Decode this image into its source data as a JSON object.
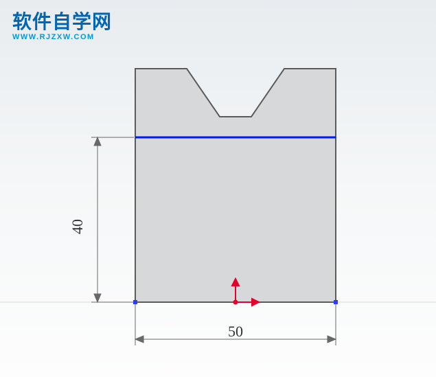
{
  "watermark": {
    "title": "软件自学网",
    "url": "WWW.RJZXW.COM"
  },
  "dimensions": {
    "height_label": "40",
    "width_label": "50"
  },
  "chart_data": {
    "type": "diagram",
    "description": "CAD 2D sketch of extruded block with V-notch on top",
    "outer_width": 50,
    "lower_rect_height": 40,
    "upper_section_height_approx": 20,
    "notch": {
      "shape": "V",
      "direction": "down",
      "top_span_fraction_approx": 0.5
    },
    "highlighted_edge": {
      "color": "blue",
      "position": "horizontal line at top of 40-height rectangle"
    },
    "origin_marker": {
      "color": "red",
      "type": "coordinate-origin-arrows",
      "position": "bottom-center"
    },
    "units": "unspecified"
  }
}
